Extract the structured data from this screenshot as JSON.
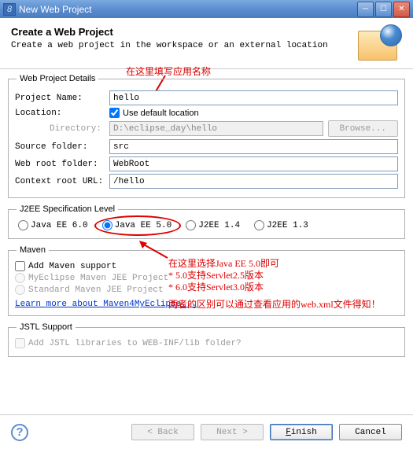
{
  "window": {
    "title": "New Web Project"
  },
  "header": {
    "title": "Create a Web Project",
    "description": "Create a web project in the workspace or an external location"
  },
  "annotations": {
    "top": "在这里填写应用名称",
    "mid1": "在这里选择Java EE 5.0即可",
    "mid2": "* 5.0支持Servlet2.5版本",
    "mid3": "* 6.0支持Servlet3.0版本",
    "mid4": "两者的区别可以通过查看应用的web.xml文件得知！"
  },
  "details": {
    "legend": "Web Project Details",
    "projectNameLabel": "Project Name:",
    "projectName": "hello",
    "locationLabel": "Location:",
    "useDefaultLocation": "Use default location",
    "directoryLabel": "Directory:",
    "directory": "D:\\eclipse_day\\hello",
    "browse": "Browse...",
    "sourceFolderLabel": "Source folder:",
    "sourceFolder": "src",
    "webRootLabel": "Web root folder:",
    "webRoot": "WebRoot",
    "contextRootLabel": "Context root URL:",
    "contextRoot": "/hello"
  },
  "j2ee": {
    "legend": "J2EE Specification Level",
    "options": [
      "Java EE 6.0",
      "Java EE 5.0",
      "J2EE 1.4",
      "J2EE 1.3"
    ],
    "selected": 1
  },
  "maven": {
    "legend": "Maven",
    "addSupport": "Add Maven support",
    "myeclipse": "MyEclipse Maven JEE Project",
    "standard": "Standard Maven JEE Project",
    "learnMore": "Learn more about Maven4MyEclipse..."
  },
  "jstl": {
    "legend": "JSTL Support",
    "addLib": "Add JSTL libraries to WEB-INF/lib folder?"
  },
  "footer": {
    "back": "< Back",
    "next": "Next >",
    "finish": "Finish",
    "cancel": "Cancel"
  }
}
